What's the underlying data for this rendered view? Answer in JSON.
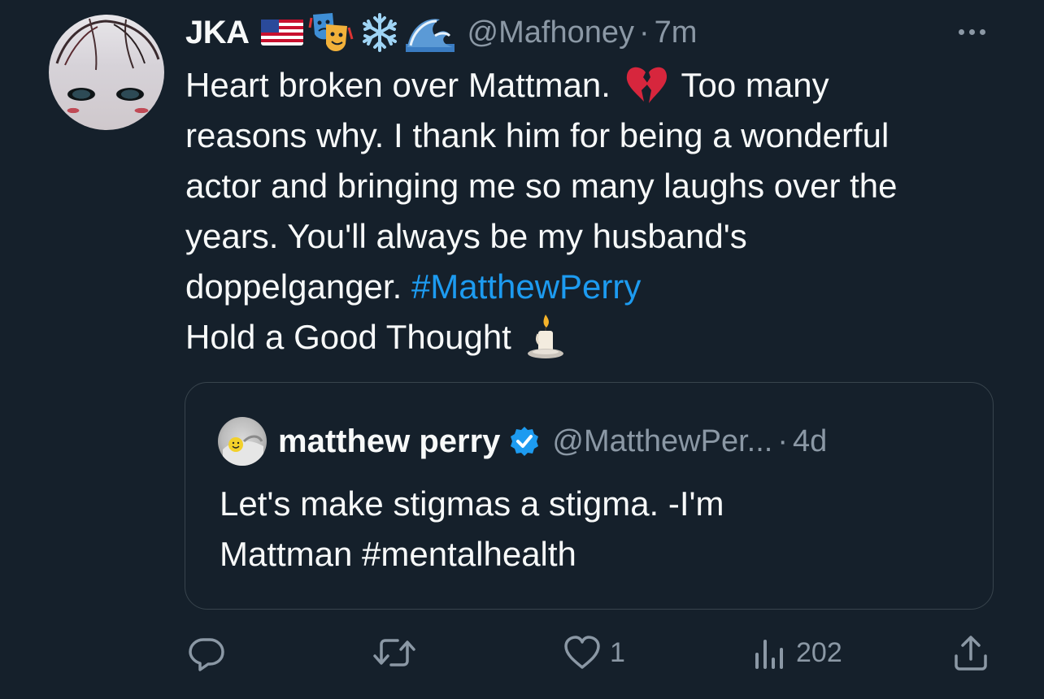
{
  "tweet": {
    "display_name": "JKA",
    "name_emojis": [
      "us-flag",
      "theater-masks",
      "snowflake",
      "wave"
    ],
    "handle": "@Mafhoney",
    "separator": "·",
    "time": "7m",
    "text_lines": [
      {
        "before": "Heart broken over Mattman.",
        "emoji": "broken-heart",
        "after": "Too many"
      },
      {
        "text": "reasons why. I thank him for being a wonderful"
      },
      {
        "text": "actor and bringing me so many laughs over the"
      },
      {
        "text": "years. You'll always be my husband's"
      },
      {
        "text": "doppelganger.",
        "hashtag": "#MatthewPerry"
      },
      {
        "text": "Hold a Good Thought",
        "emoji": "candle"
      }
    ]
  },
  "quote": {
    "name": "matthew perry",
    "verified": true,
    "handle": "@MatthewPer...",
    "separator": "·",
    "time": "4d",
    "text_lines": [
      "Let's make stigmas a stigma. -I'm",
      "Mattman #mentalhealth"
    ]
  },
  "actions": {
    "reply_count": "",
    "retweet_count": "",
    "like_count": "1",
    "views_count": "202"
  },
  "colors": {
    "background": "#15202b",
    "text": "#f7f9f9",
    "muted": "#8b98a5",
    "accent": "#1d9bf0",
    "border": "#38444d"
  }
}
